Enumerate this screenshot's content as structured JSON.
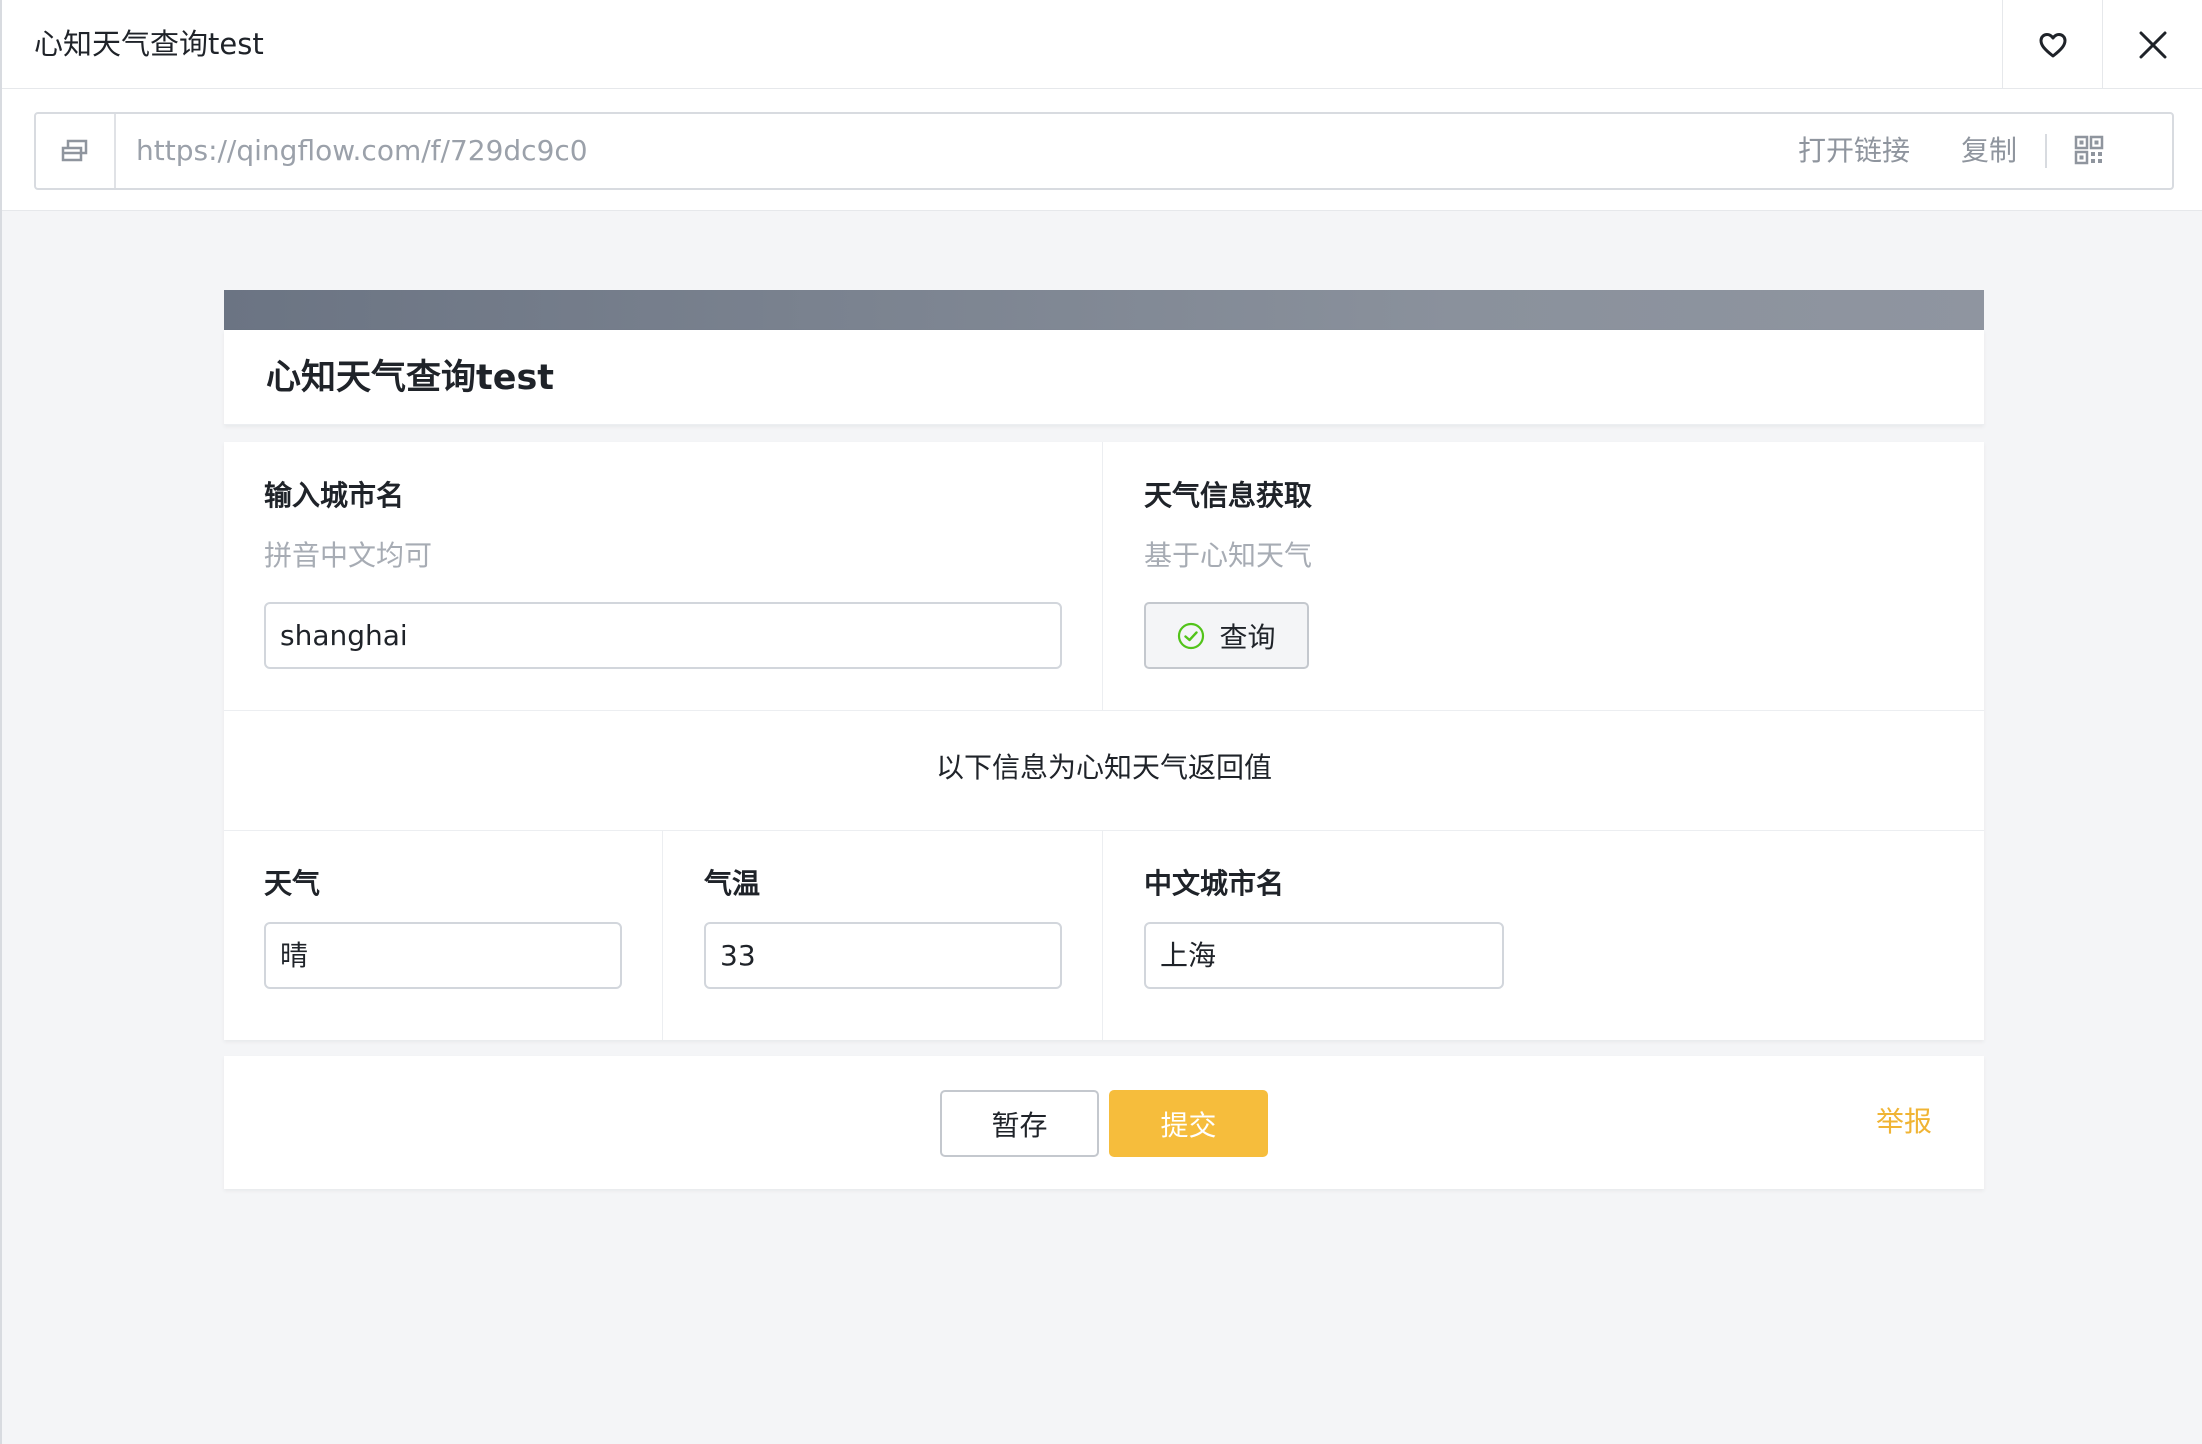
{
  "window": {
    "title": "心知天气查询test"
  },
  "urlbar": {
    "url": "https://qingflow.com/f/729dc9c0",
    "open_link_label": "打开链接",
    "copy_label": "复制"
  },
  "form": {
    "title": "心知天气查询test",
    "city_field": {
      "label": "输入城市名",
      "hint": "拼音中文均可",
      "value": "shanghai"
    },
    "weather_fetch": {
      "label": "天气信息获取",
      "hint": "基于心知天气",
      "button_label": "查询"
    },
    "section_text": "以下信息为心知天气返回值",
    "weather": {
      "label": "天气",
      "value": "晴"
    },
    "temperature": {
      "label": "气温",
      "value": "33"
    },
    "cn_city": {
      "label": "中文城市名",
      "value": "上海"
    }
  },
  "footer": {
    "save_label": "暂存",
    "submit_label": "提交",
    "report_label": "举报"
  },
  "colors": {
    "accent": "#f6bd3c",
    "report": "#f0b434",
    "check": "#52c41a"
  }
}
